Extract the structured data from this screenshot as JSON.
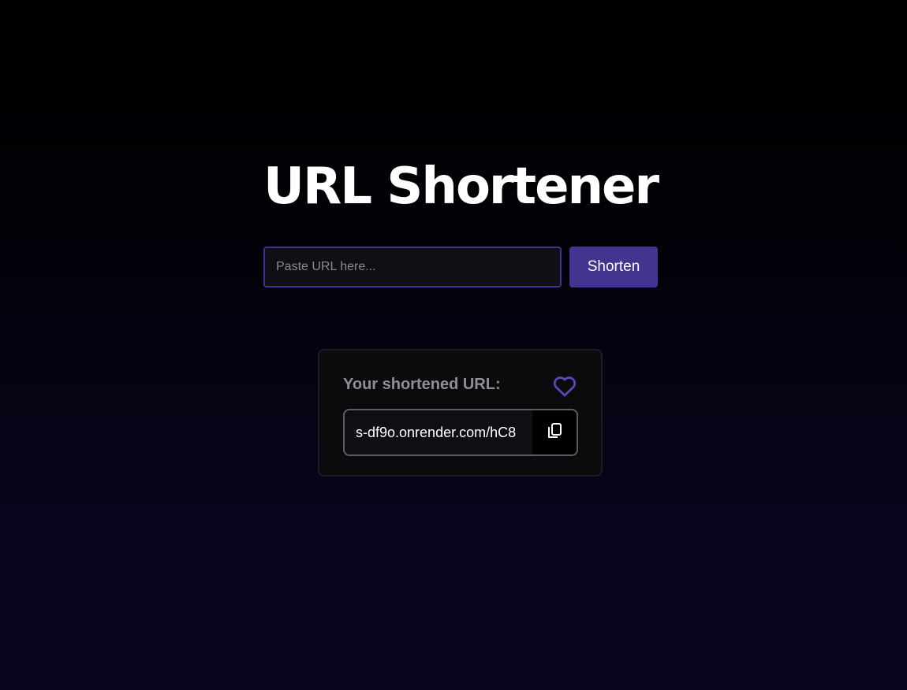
{
  "header": {
    "title": "URL Shortener"
  },
  "form": {
    "input_placeholder": "Paste URL here...",
    "input_value": "",
    "submit_label": "Shorten"
  },
  "result": {
    "label": "Your shortened URL:",
    "short_url": "s-df9o.onrender.com/hC8",
    "favorite_icon": "heart-outline-icon",
    "copy_icon": "copy-icon"
  },
  "colors": {
    "accent": "#43348f",
    "input_border": "#3e3390",
    "label_gray": "#8f8f96",
    "heart": "#5b46b8"
  }
}
